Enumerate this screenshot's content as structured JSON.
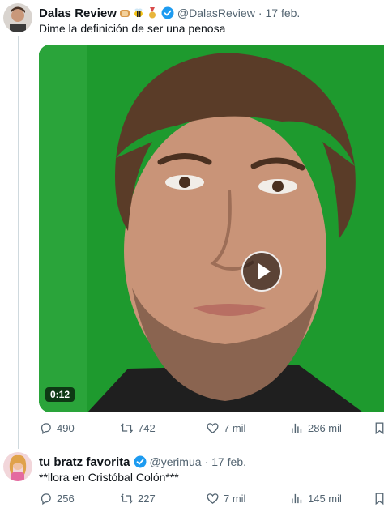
{
  "tweets": [
    {
      "name": "Dalas Review",
      "emoji_icons": [
        "bread-emoji",
        "bee-emoji",
        "medal-emoji"
      ],
      "handle": "@DalasReview",
      "separator": "·",
      "date": "17 feb.",
      "text": "Dime la definición de ser una penosa",
      "video_duration": "0:12",
      "replies": "490",
      "reposts": "742",
      "likes": "7 mil",
      "views": "286 mil"
    },
    {
      "name": "tu bratz favorita",
      "handle": "@yerimua",
      "separator": "·",
      "date": "17 feb.",
      "text": "**llora en Cristóbal Colón***",
      "replies": "256",
      "reposts": "227",
      "likes": "7 mil",
      "views": "145 mil"
    }
  ],
  "colors": {
    "text_primary": "#0f1419",
    "text_secondary": "#536471",
    "verified_blue": "#1d9bf0",
    "video_background": "#1b8f2a"
  }
}
